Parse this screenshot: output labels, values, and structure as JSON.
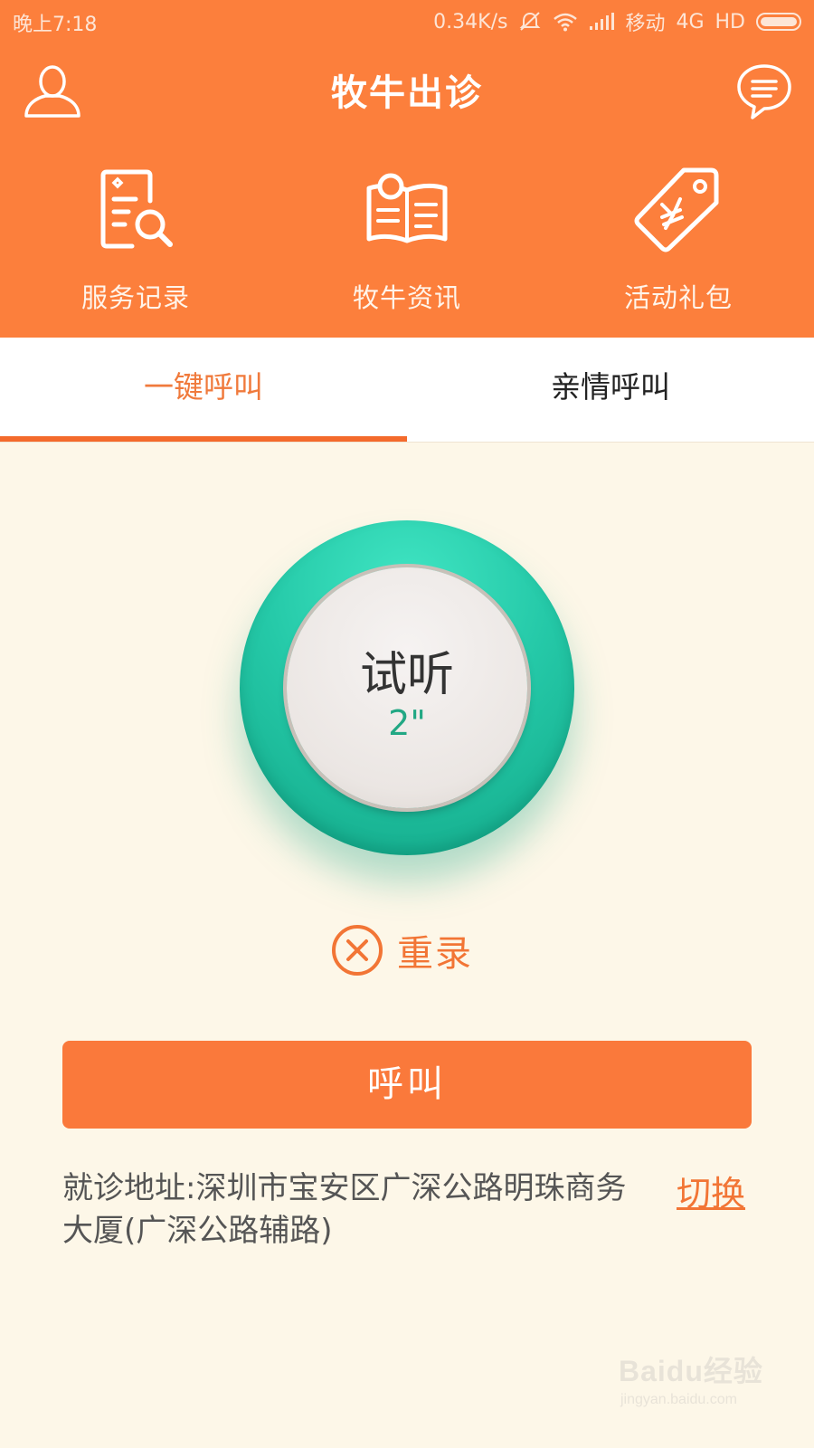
{
  "status_bar": {
    "time": "晚上7:18",
    "speed": "0.34K/s",
    "carrier": "移动",
    "network": "4G",
    "hd": "HD"
  },
  "header": {
    "title": "牧牛出诊",
    "profile_icon": "person-icon",
    "message_icon": "chat-bubble-icon"
  },
  "quick_menu": [
    {
      "label": "服务记录",
      "icon": "document-search-icon"
    },
    {
      "label": "牧牛资讯",
      "icon": "open-book-icon"
    },
    {
      "label": "活动礼包",
      "icon": "price-tag-icon"
    }
  ],
  "tabs": [
    {
      "label": "一键呼叫",
      "active": true
    },
    {
      "label": "亲情呼叫",
      "active": false
    }
  ],
  "record_button": {
    "label": "试听",
    "duration": "2\""
  },
  "rerecord": {
    "label": "重录"
  },
  "call_button": {
    "label": "呼叫"
  },
  "address": {
    "text": "就诊地址:深圳市宝安区广深公路明珠商务大厦(广深公路辅路)",
    "switch_label": "切换"
  },
  "watermark": {
    "logo_text": "Baidu经验",
    "url": "jingyan.baidu.com"
  },
  "colors": {
    "primary": "#fc7f3c",
    "accent_teal": "#25c9a8",
    "background": "#fdf7e8",
    "tab_active": "#f07a3c"
  }
}
